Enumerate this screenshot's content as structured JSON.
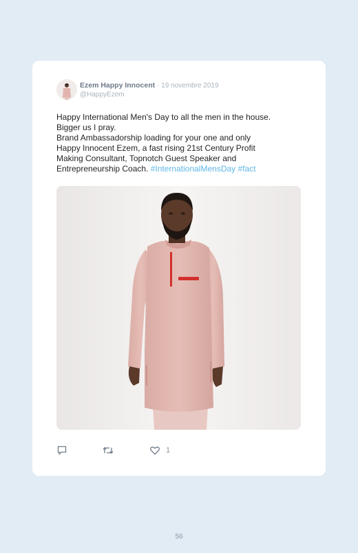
{
  "post": {
    "author_name": "Ezem Happy Innocent",
    "separator": "·",
    "date": "19 novembre 2019",
    "handle": "@HappyEzem",
    "text_lines": [
      "Happy International Men's Day to all the men in the house.",
      "Bigger us I pray.",
      "Brand Ambassadorship loading for your one and only",
      "Happy Innocent Ezem, a fast rising 21st Century Profit",
      "Making Consultant, Topnotch Guest Speaker and"
    ],
    "last_line_text": "Entrepreneurship Coach. ",
    "hashtags": [
      "#InternationalMensDay",
      "#fact"
    ],
    "like_count": "1"
  },
  "icons": {
    "reply": "comment-icon",
    "retweet": "retweet-icon",
    "like": "heart-icon"
  },
  "colors": {
    "page_background": "#e1ecf5",
    "card_background": "#ffffff",
    "hashtag": "#5fb7e5",
    "tunic": "#e1b5ae",
    "accent_red": "#d2302c"
  },
  "page_number": "56"
}
